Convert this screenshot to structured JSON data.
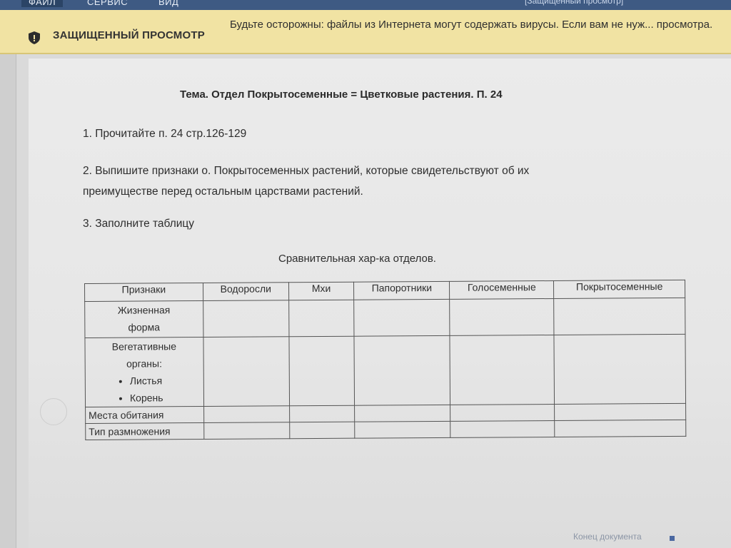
{
  "menu": {
    "items": [
      "ФАЙЛ",
      "СЕРВИС",
      "ВИД"
    ],
    "right_title": "[Защищенный просмотр]"
  },
  "infobar": {
    "title": "ЗАЩИЩЕННЫЙ ПРОСМОТР",
    "message": "Будьте осторожны: файлы из Интернета могут содержать вирусы. Если вам не нуж... просмотра.",
    "icon": "shield-icon"
  },
  "document": {
    "title": "Тема. Отдел Покрытосеменные = Цветковые растения. П. 24",
    "item1": "1. Прочитайте п. 24 стр.126-129",
    "item2_line1": "2. Выпишите признаки о. Покрытосеменных растений, которые свидетельствуют об их",
    "item2_line2": "преимуществе перед  остальным  царствами растений.",
    "item3": "3. Заполните таблицу",
    "table_caption": "Сравнительная хар-ка отделов.",
    "table": {
      "headers": [
        "Признаки",
        "Водоросли",
        "Мхи",
        "Папоротники",
        "Голосеменные",
        "Покрытосеменные"
      ],
      "row_life_line1": "Жизненная",
      "row_life_line2": "форма",
      "row_veg_line1": "Вегетативные",
      "row_veg_line2": "органы:",
      "row_veg_bullets": [
        "Листья",
        "Корень"
      ],
      "row_habitat": "Места обитания",
      "row_reproduction": "Тип размножения"
    },
    "end_label": "Конец документа"
  },
  "colors": {
    "menubar": "#3e5a83",
    "infobar": "#f1e3a3",
    "page": "#e8e8e8"
  }
}
